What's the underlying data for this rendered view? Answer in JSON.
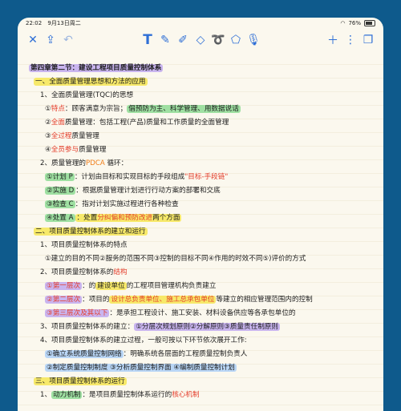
{
  "status": {
    "time": "22:02",
    "date": "9月13日周二",
    "battery": "76%"
  },
  "toolbar_icons": [
    "close-icon",
    "share-icon",
    "undo-icon",
    "text-tool-icon",
    "pen-icon",
    "highlighter-icon",
    "eraser-icon",
    "lasso-icon",
    "shapes-icon",
    "microphone-icon",
    "add-icon",
    "more-icon",
    "pages-icon"
  ],
  "note": {
    "title": "第四章第二节：建设工程项目质量控制体系",
    "s1": "一、全面质量管理思想和方法的应用",
    "l1": "1、全面质量管理(TQC)的思想",
    "l1a_num": "①",
    "l1a_key": "特点",
    "l1a_text": "：顾客满意为宗旨；",
    "l1a_hl": "倡预防为主、科学管理、用数据说话",
    "l1b_num": "②",
    "l1b_key": "全面",
    "l1b_text": "质量管理：包括工程(产品)质量和工作质量的全面管理",
    "l1c_num": "③",
    "l1c_key": "全过程",
    "l1c_text": "质量管理",
    "l1d_num": "④",
    "l1d_key": "全员参与",
    "l1d_text": "质量管理",
    "l2_a": "2、质量管理的",
    "l2_key": "PDCA",
    "l2_b": " 循环：",
    "p1_hl": "①计划 P",
    "p1_text": "：计划由目标和实现目标的手段组成",
    "p1_key": "\"目标-手段链\"",
    "p2_hl": "②实施 D",
    "p2_text": "：根据质量管理计划进行行动方案的部署和交底",
    "p3_hl": "③检查 C",
    "p3_text": "：指对计划实施过程进行各种检查",
    "p4_hl": "④处置 A",
    "p4_text": "：处置",
    "p4_key": "分纠偏和预防改进",
    "p4_tail": "两个方面",
    "s2": "二、项目质量控制体系的建立和运行",
    "l3": "1、项目质量控制体系的特点",
    "l3a": "①建立的目的不同②服务的范围不同③控制的目标不同④作用的时效不同⑤)评价的方式",
    "l4_a": "2、项目质量控制体系的",
    "l4_key": "结构",
    "t1_hl": "①第一层次",
    "t1_text": "：的",
    "t1_key": "建设单位",
    "t1_tail": "的工程项目管理机构负责建立",
    "t2_hl": "②第二层次",
    "t2_text": "：项目的",
    "t2_key": "设计总负责单位、施工总承包单位",
    "t2_tail": "等建立的相应管理范围内的控制",
    "t3_hl": "③第三层次及其以下",
    "t3_text": "：是承担工程设计、施工安装、材料设备供应等各承包单位的",
    "l5_a": "3、项目质量控制体系的建立：",
    "l5_hl": "①分层次规划原则②分解原则③质量责任制原则",
    "l6": "4、项目质量控制体系的建立过程，一般可按以下环节依次展开工作:",
    "l6a_hl": "①确立系统质量控制网络",
    "l6a_text": "：明确系统各层面的工程质量控制负责人",
    "l6b_hl": "②制定质量控制制度 ③分析质量控制界面 ④编制质量控制计划",
    "s3": "三、项目质量控制体系的运行",
    "l7_a": "1、",
    "l7_hl": "动力机制",
    "l7_text": "：是项目质量控制体系运行的",
    "l7_key": "核心机制"
  }
}
